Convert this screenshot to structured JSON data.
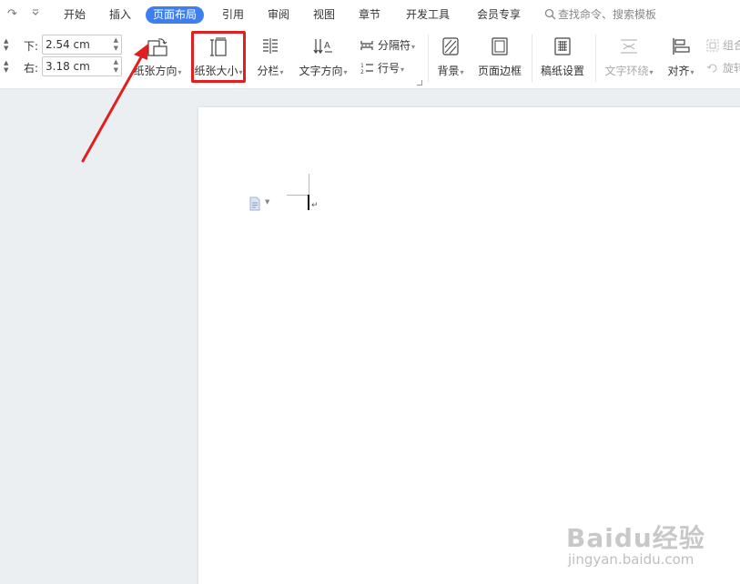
{
  "menu": {
    "tabs": [
      {
        "label": "开始"
      },
      {
        "label": "插入"
      },
      {
        "label": "页面布局",
        "active": true
      },
      {
        "label": "引用"
      },
      {
        "label": "审阅"
      },
      {
        "label": "视图"
      },
      {
        "label": "章节"
      },
      {
        "label": "开发工具"
      },
      {
        "label": "会员专享"
      }
    ],
    "search_label": "查找命令、搜索模板"
  },
  "ribbon": {
    "margins": {
      "bottom": {
        "label": "下:",
        "value": "2.54 cm"
      },
      "right": {
        "label": "右:",
        "value": "3.18 cm"
      }
    },
    "buttons": {
      "orientation": "纸张方向",
      "size": "纸张大小",
      "columns": "分栏",
      "text_direction": "文字方向",
      "breaks": "分隔符",
      "line_numbers": "行号",
      "background": "背景",
      "page_border": "页面边框",
      "manuscript": "稿纸设置",
      "text_wrap": "文字环绕",
      "align": "对齐",
      "group": "组合",
      "rotate": "旋转"
    }
  },
  "watermark": {
    "brand": "Baidu经验",
    "url": "jingyan.baidu.com"
  },
  "colors": {
    "accent": "#3d7ff0",
    "highlight": "#e02020",
    "doc_background": "#eceff1"
  }
}
